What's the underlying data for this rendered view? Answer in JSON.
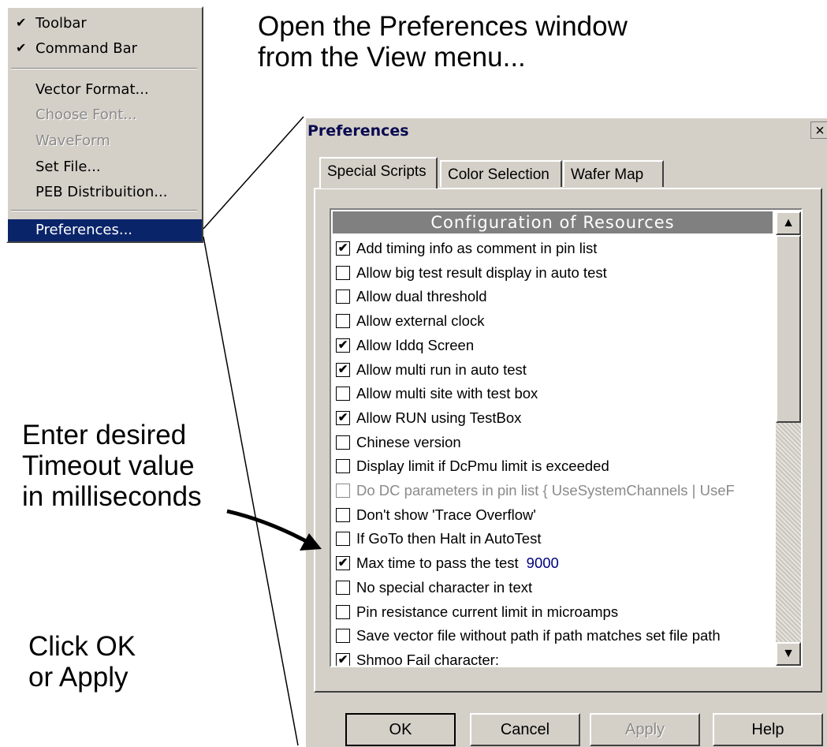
{
  "annotations": {
    "open_prefs_line1": "Open the Preferences window",
    "open_prefs_line2": "from the View menu...",
    "timeout_line1": "Enter desired",
    "timeout_line2": "Timeout value",
    "timeout_line3": "in milliseconds",
    "click_ok_line1": "Click OK",
    "click_ok_line2": "or Apply"
  },
  "view_menu": {
    "check_glyph": "✔",
    "items": [
      {
        "label": "Toolbar",
        "checked": true
      },
      {
        "label": "Command Bar",
        "checked": true
      },
      {
        "label": "Vector Format..."
      },
      {
        "label": "Choose Font...",
        "disabled": true
      },
      {
        "label": "WaveForm",
        "disabled": true
      },
      {
        "label": "Set File..."
      },
      {
        "label": "PEB Distribuition..."
      },
      {
        "label": "Preferences...",
        "selected": true
      }
    ]
  },
  "preferences": {
    "title": "Preferences",
    "close_glyph": "×",
    "tabs": [
      "Special Scripts",
      "Color Selection",
      "Wafer Map"
    ],
    "active_tab": "Special Scripts",
    "list_header": "Configuration of Resources",
    "check_glyph": "✔",
    "items": [
      {
        "label": "Add timing info as comment in pin list",
        "checked": true
      },
      {
        "label": "Allow big test result display in auto test",
        "checked": false
      },
      {
        "label": "Allow dual threshold",
        "checked": false
      },
      {
        "label": "Allow external clock",
        "checked": false
      },
      {
        "label": "Allow Iddq Screen",
        "checked": true
      },
      {
        "label": "Allow multi run in auto test",
        "checked": true
      },
      {
        "label": "Allow multi site with test box",
        "checked": false
      },
      {
        "label": "Allow RUN using TestBox",
        "checked": true
      },
      {
        "label": "Chinese version",
        "checked": false
      },
      {
        "label": "Display limit if DcPmu limit is exceeded",
        "checked": false
      },
      {
        "label": "Do DC parameters in pin list  { UseSystemChannels | UseF",
        "checked": false,
        "disabled": true
      },
      {
        "label": "Don't show 'Trace Overflow'",
        "checked": false
      },
      {
        "label": "If GoTo then Halt in AutoTest",
        "checked": false
      },
      {
        "label": "Max time to pass the test",
        "checked": true,
        "value": "9000"
      },
      {
        "label": "No special character in text",
        "checked": false
      },
      {
        "label": "Pin resistance current limit in microamps",
        "checked": false
      },
      {
        "label": "Save vector file without path if path matches set file path",
        "checked": false
      },
      {
        "label": "Shmoo Fail character:",
        "checked": true
      }
    ],
    "scroll_up_glyph": "▲",
    "scroll_down_glyph": "▼",
    "buttons": {
      "ok": "OK",
      "cancel": "Cancel",
      "apply": "Apply",
      "help": "Help"
    }
  }
}
